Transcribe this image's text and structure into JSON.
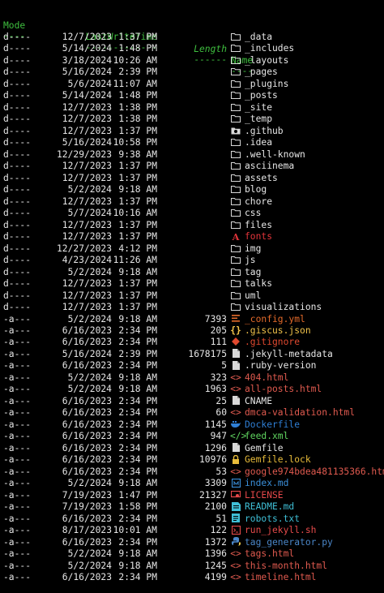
{
  "colors": {
    "header": "#3fbf3f",
    "text": "#e6e6e6",
    "folder": "#d8d8d8",
    "fonts_red": "#e3343a",
    "yaml_orange": "#e46a2a",
    "json_yellow": "#f0c24a",
    "git_red": "#e0492f",
    "html_red": "#e05a4f",
    "docker_blue": "#2f7fd5",
    "xml_green": "#5fd35f",
    "lock_yellow": "#e8bc3a",
    "md_blue": "#3a8ed8",
    "license_red": "#e5484a",
    "readme_cyan": "#3fbfd6",
    "shell_red": "#e44a4a",
    "python_blue": "#4a86c8"
  },
  "header": {
    "mode": "Mode",
    "lastwritetime": "LastWriteTime",
    "length": "Length",
    "name": "Name",
    "mode_rule": "----",
    "lastwritetime_rule": "-------------",
    "length_rule": "------",
    "name_rule": "----"
  },
  "entries": [
    {
      "mode": "d----",
      "date": "12/7/2023",
      "time": "1:37 PM",
      "length": "",
      "icon": "folder-icon",
      "name": "_data",
      "color": "#e6e6e6"
    },
    {
      "mode": "d----",
      "date": "5/14/2024",
      "time": "1:48 PM",
      "length": "",
      "icon": "folder-icon",
      "name": "_includes",
      "color": "#e6e6e6"
    },
    {
      "mode": "d----",
      "date": "3/18/2024",
      "time": "10:26 AM",
      "length": "",
      "icon": "folder-icon",
      "name": "_layouts",
      "color": "#e6e6e6"
    },
    {
      "mode": "d----",
      "date": "5/16/2024",
      "time": "2:39 PM",
      "length": "",
      "icon": "folder-icon",
      "name": "_pages",
      "color": "#e6e6e6"
    },
    {
      "mode": "d----",
      "date": "5/6/2024",
      "time": "11:07 AM",
      "length": "",
      "icon": "folder-icon",
      "name": "_plugins",
      "color": "#e6e6e6"
    },
    {
      "mode": "d----",
      "date": "5/14/2024",
      "time": "1:48 PM",
      "length": "",
      "icon": "folder-icon",
      "name": "_posts",
      "color": "#e6e6e6"
    },
    {
      "mode": "d----",
      "date": "12/7/2023",
      "time": "1:38 PM",
      "length": "",
      "icon": "folder-icon",
      "name": "_site",
      "color": "#e6e6e6"
    },
    {
      "mode": "d----",
      "date": "12/7/2023",
      "time": "1:38 PM",
      "length": "",
      "icon": "folder-icon",
      "name": "_temp",
      "color": "#e6e6e6"
    },
    {
      "mode": "d----",
      "date": "12/7/2023",
      "time": "1:37 PM",
      "length": "",
      "icon": "github-folder-icon",
      "name": ".github",
      "color": "#e6e6e6"
    },
    {
      "mode": "d----",
      "date": "5/16/2024",
      "time": "10:58 PM",
      "length": "",
      "icon": "folder-icon",
      "name": ".idea",
      "color": "#e6e6e6"
    },
    {
      "mode": "d----",
      "date": "12/29/2023",
      "time": "9:38 AM",
      "length": "",
      "icon": "folder-icon",
      "name": ".well-known",
      "color": "#e6e6e6"
    },
    {
      "mode": "d----",
      "date": "12/7/2023",
      "time": "1:37 PM",
      "length": "",
      "icon": "folder-icon",
      "name": "asciinema",
      "color": "#e6e6e6"
    },
    {
      "mode": "d----",
      "date": "12/7/2023",
      "time": "1:37 PM",
      "length": "",
      "icon": "folder-icon",
      "name": "assets",
      "color": "#e6e6e6"
    },
    {
      "mode": "d----",
      "date": "5/2/2024",
      "time": "9:18 AM",
      "length": "",
      "icon": "folder-icon",
      "name": "blog",
      "color": "#e6e6e6"
    },
    {
      "mode": "d----",
      "date": "12/7/2023",
      "time": "1:37 PM",
      "length": "",
      "icon": "folder-icon",
      "name": "chore",
      "color": "#e6e6e6"
    },
    {
      "mode": "d----",
      "date": "5/7/2024",
      "time": "10:16 AM",
      "length": "",
      "icon": "folder-icon",
      "name": "css",
      "color": "#e6e6e6"
    },
    {
      "mode": "d----",
      "date": "12/7/2023",
      "time": "1:37 PM",
      "length": "",
      "icon": "folder-icon",
      "name": "files",
      "color": "#e6e6e6"
    },
    {
      "mode": "d----",
      "date": "12/7/2023",
      "time": "1:37 PM",
      "length": "",
      "icon": "fonts-icon",
      "name": "fonts",
      "color": "#e3343a"
    },
    {
      "mode": "d----",
      "date": "12/27/2023",
      "time": "4:12 PM",
      "length": "",
      "icon": "folder-icon",
      "name": "img",
      "color": "#e6e6e6"
    },
    {
      "mode": "d----",
      "date": "4/23/2024",
      "time": "11:26 AM",
      "length": "",
      "icon": "folder-icon",
      "name": "js",
      "color": "#e6e6e6"
    },
    {
      "mode": "d----",
      "date": "5/2/2024",
      "time": "9:18 AM",
      "length": "",
      "icon": "folder-icon",
      "name": "tag",
      "color": "#e6e6e6"
    },
    {
      "mode": "d----",
      "date": "12/7/2023",
      "time": "1:37 PM",
      "length": "",
      "icon": "folder-icon",
      "name": "talks",
      "color": "#e6e6e6"
    },
    {
      "mode": "d----",
      "date": "12/7/2023",
      "time": "1:37 PM",
      "length": "",
      "icon": "folder-icon",
      "name": "uml",
      "color": "#e6e6e6"
    },
    {
      "mode": "d----",
      "date": "12/7/2023",
      "time": "1:37 PM",
      "length": "",
      "icon": "folder-icon",
      "name": "visualizations",
      "color": "#e6e6e6"
    },
    {
      "mode": "-a---",
      "date": "5/2/2024",
      "time": "9:18 AM",
      "length": "7393",
      "icon": "yaml-icon",
      "name": "_config.yml",
      "color": "#e46a2a"
    },
    {
      "mode": "-a---",
      "date": "6/16/2023",
      "time": "2:34 PM",
      "length": "205",
      "icon": "json-icon",
      "name": ".giscus.json",
      "color": "#f0c24a"
    },
    {
      "mode": "-a---",
      "date": "6/16/2023",
      "time": "2:34 PM",
      "length": "111",
      "icon": "git-icon",
      "name": ".gitignore",
      "color": "#e0492f"
    },
    {
      "mode": "-a---",
      "date": "5/16/2024",
      "time": "2:39 PM",
      "length": "1678175",
      "icon": "file-icon",
      "name": ".jekyll-metadata",
      "color": "#e6e6e6"
    },
    {
      "mode": "-a---",
      "date": "6/16/2023",
      "time": "2:34 PM",
      "length": "5",
      "icon": "file-icon",
      "name": ".ruby-version",
      "color": "#e6e6e6"
    },
    {
      "mode": "-a---",
      "date": "5/2/2024",
      "time": "9:18 AM",
      "length": "323",
      "icon": "html-icon",
      "name": "404.html",
      "color": "#e05a4f"
    },
    {
      "mode": "-a---",
      "date": "5/2/2024",
      "time": "9:18 AM",
      "length": "1963",
      "icon": "html-icon",
      "name": "all-posts.html",
      "color": "#e05a4f"
    },
    {
      "mode": "-a---",
      "date": "6/16/2023",
      "time": "2:34 PM",
      "length": "25",
      "icon": "file-icon",
      "name": "CNAME",
      "color": "#e6e6e6"
    },
    {
      "mode": "-a---",
      "date": "6/16/2023",
      "time": "2:34 PM",
      "length": "60",
      "icon": "html-icon",
      "name": "dmca-validation.html",
      "color": "#e05a4f"
    },
    {
      "mode": "-a---",
      "date": "6/16/2023",
      "time": "2:34 PM",
      "length": "1145",
      "icon": "docker-icon",
      "name": "Dockerfile",
      "color": "#2f7fd5"
    },
    {
      "mode": "-a---",
      "date": "6/16/2023",
      "time": "2:34 PM",
      "length": "947",
      "icon": "xml-icon",
      "name": "feed.xml",
      "color": "#5fd35f"
    },
    {
      "mode": "-a---",
      "date": "6/16/2023",
      "time": "2:34 PM",
      "length": "1296",
      "icon": "file-icon",
      "name": "Gemfile",
      "color": "#e6e6e6"
    },
    {
      "mode": "-a---",
      "date": "6/16/2023",
      "time": "2:34 PM",
      "length": "10976",
      "icon": "lock-icon",
      "name": "Gemfile.lock",
      "color": "#e8bc3a"
    },
    {
      "mode": "-a---",
      "date": "6/16/2023",
      "time": "2:34 PM",
      "length": "53",
      "icon": "html-icon",
      "name": "google974bdea481135366.html",
      "color": "#e05a4f"
    },
    {
      "mode": "-a---",
      "date": "5/2/2024",
      "time": "9:18 AM",
      "length": "3309",
      "icon": "markdown-icon",
      "name": "index.md",
      "color": "#3a8ed8"
    },
    {
      "mode": "-a---",
      "date": "7/19/2023",
      "time": "1:47 PM",
      "length": "21327",
      "icon": "license-icon",
      "name": "LICENSE",
      "color": "#e5484a"
    },
    {
      "mode": "-a---",
      "date": "7/19/2023",
      "time": "1:58 PM",
      "length": "2100",
      "icon": "readme-icon",
      "name": "README.md",
      "color": "#3fbfd6"
    },
    {
      "mode": "-a---",
      "date": "6/16/2023",
      "time": "2:34 PM",
      "length": "51",
      "icon": "text-icon",
      "name": "robots.txt",
      "color": "#3fbfd6"
    },
    {
      "mode": "-a---",
      "date": "8/17/2023",
      "time": "10:01 AM",
      "length": "122",
      "icon": "shell-icon",
      "name": "run_jekyll.sh",
      "color": "#e44a4a"
    },
    {
      "mode": "-a---",
      "date": "6/16/2023",
      "time": "2:34 PM",
      "length": "1372",
      "icon": "python-icon",
      "name": "tag_generator.py",
      "color": "#4a86c8"
    },
    {
      "mode": "-a---",
      "date": "5/2/2024",
      "time": "9:18 AM",
      "length": "1396",
      "icon": "html-icon",
      "name": "tags.html",
      "color": "#e05a4f"
    },
    {
      "mode": "-a---",
      "date": "5/2/2024",
      "time": "9:18 AM",
      "length": "1245",
      "icon": "html-icon",
      "name": "this-month.html",
      "color": "#e05a4f"
    },
    {
      "mode": "-a---",
      "date": "6/16/2023",
      "time": "2:34 PM",
      "length": "4199",
      "icon": "html-icon",
      "name": "timeline.html",
      "color": "#e05a4f"
    }
  ]
}
